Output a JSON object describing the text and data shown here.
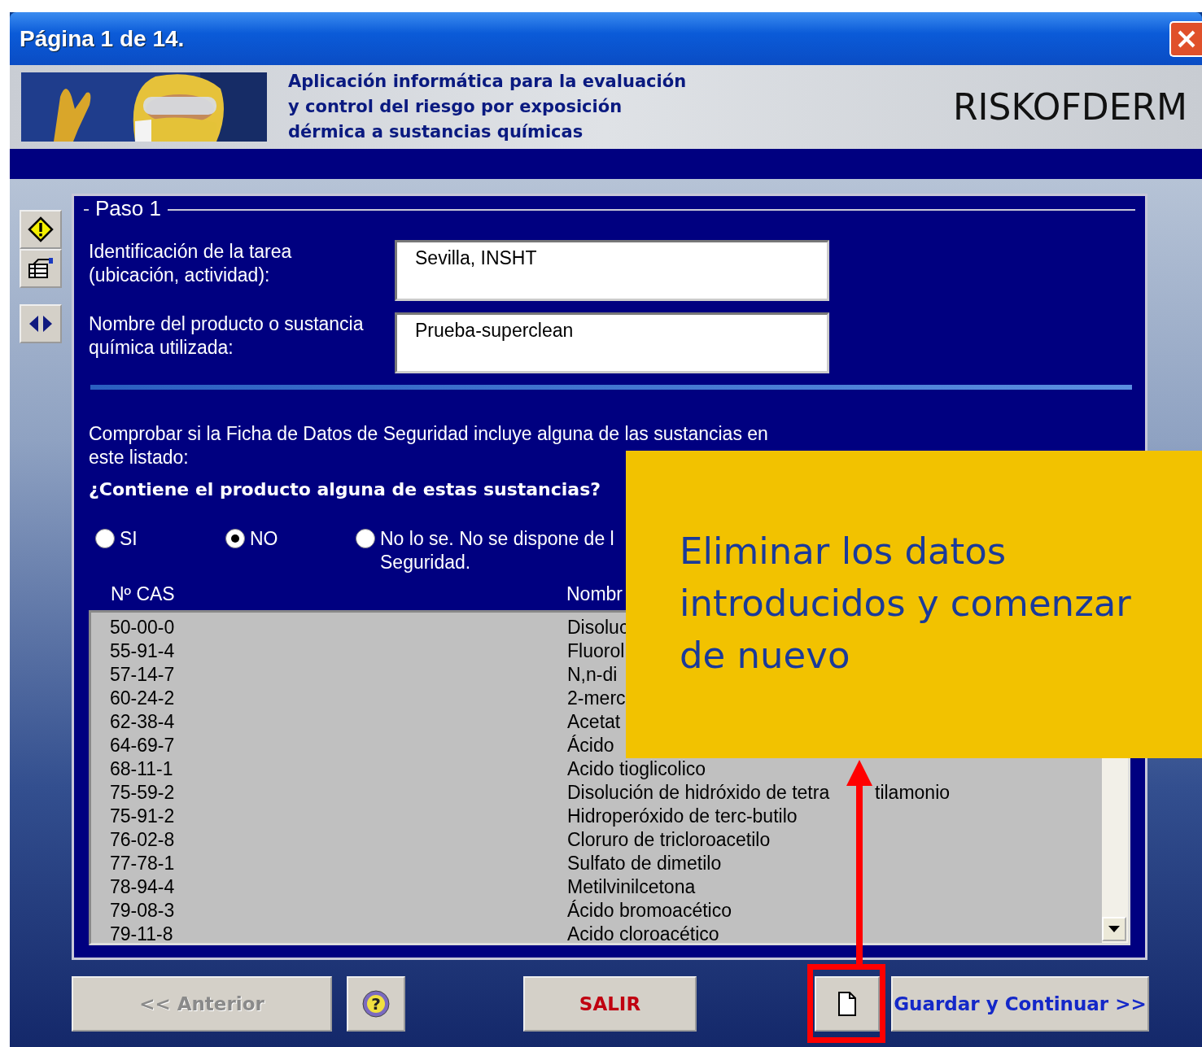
{
  "window": {
    "title": "Página 1 de 14."
  },
  "header": {
    "description": "Aplicación informática para la evaluación y control  del riesgo por exposición dérmica a sustancias químicas",
    "brand": "RISKOFDERM"
  },
  "step": {
    "legend": "Paso 1",
    "fields": [
      {
        "label": "Identificación de la tarea (ubicación, actividad):",
        "value": "Sevilla, INSHT"
      },
      {
        "label": "Nombre del producto o sustancia química utilizada:",
        "value": "Prueba-superclean"
      }
    ],
    "instruction": "Comprobar si la Ficha de Datos de Seguridad incluye alguna de las sustancias en este listado:",
    "question": "¿Contiene el producto alguna de estas sustancias?",
    "options": [
      {
        "label": [
          "SI"
        ],
        "selected": false
      },
      {
        "label": [
          "NO"
        ],
        "selected": true
      },
      {
        "label": [
          "No lo se. No se dispone de l",
          "Seguridad."
        ],
        "selected": false
      }
    ],
    "columns": [
      "Nº CAS",
      "Nombr"
    ],
    "rows": [
      [
        "50-00-0",
        "Disoluc"
      ],
      [
        "55-91-4",
        "Fluorol"
      ],
      [
        "57-14-7",
        "N,n-di"
      ],
      [
        "60-24-2",
        "2-merc"
      ],
      [
        "62-38-4",
        "Acetat"
      ],
      [
        "64-69-7",
        "Ácido"
      ],
      [
        "68-11-1",
        "Acido tioglicolico"
      ],
      [
        "75-59-2",
        "Disolución de hidróxido de tetra",
        "tilamonio"
      ],
      [
        "75-91-2",
        "Hidroperóxido de terc-butilo"
      ],
      [
        "76-02-8",
        "Cloruro de tricloroacetilo"
      ],
      [
        "77-78-1",
        "Sulfato de dimetilo"
      ],
      [
        "78-94-4",
        "Metilvinilcetona"
      ],
      [
        "79-08-3",
        "Ácido bromoacético"
      ],
      [
        "79-11-8",
        "Acido cloroacético"
      ]
    ]
  },
  "buttons": [
    {
      "kind": "back",
      "label": "<< Anterior",
      "disabled": true
    },
    {
      "kind": "help",
      "label": "?",
      "disabled": false
    },
    {
      "kind": "exit",
      "label": "SALIR",
      "disabled": false
    },
    {
      "kind": "new",
      "disabled": false
    },
    {
      "kind": "next",
      "label": "Guardar y Continuar >>",
      "disabled": false
    }
  ],
  "callout": {
    "text": "Eliminar los datos introducidos y comenzar de nuevo"
  }
}
